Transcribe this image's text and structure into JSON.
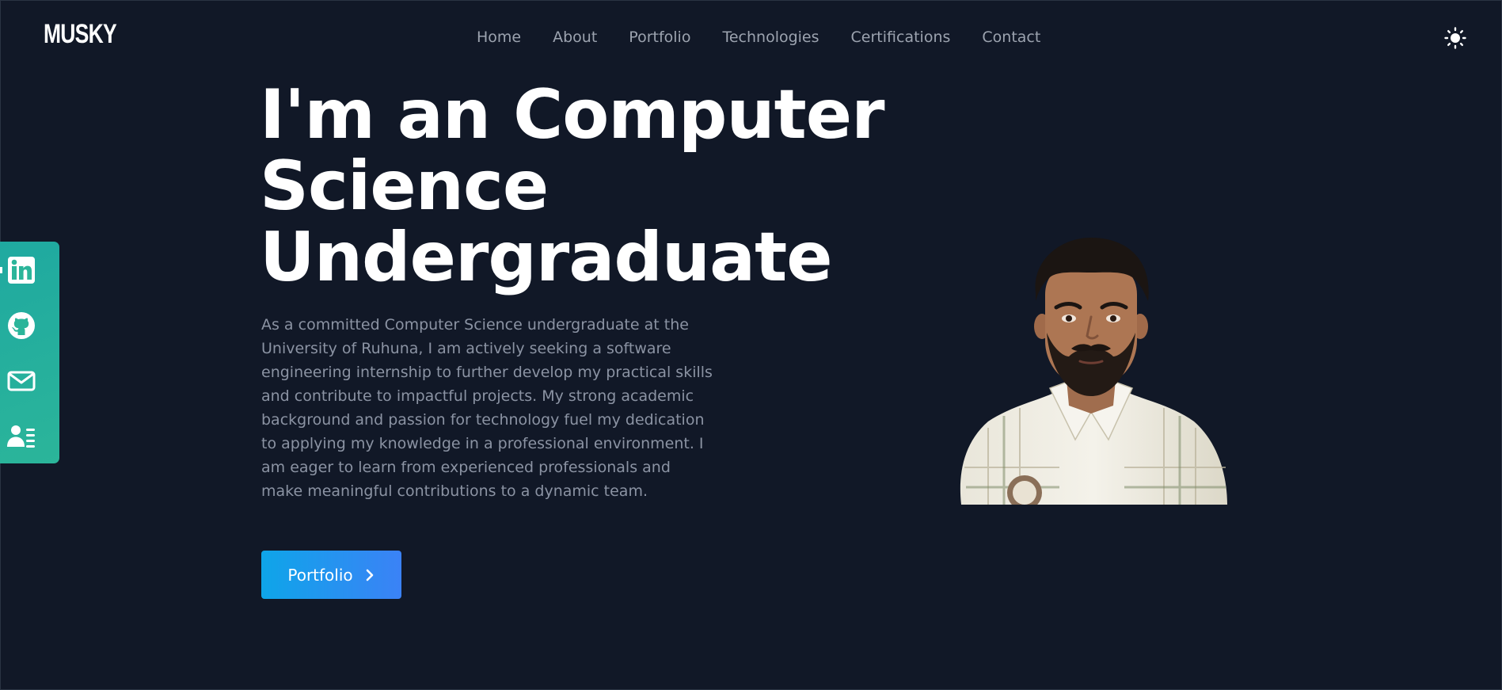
{
  "header": {
    "logo": "MUSKY",
    "nav": [
      "Home",
      "About",
      "Portfolio",
      "Technologies",
      "Certifications",
      "Contact"
    ],
    "theme_icon": "sun-icon"
  },
  "hero": {
    "title_line1": "I'm an Computer",
    "title_line2": "Science",
    "title_line3": "Undergraduate",
    "description": "As a committed Computer Science undergraduate at the University of Ruhuna, I am actively seeking a software engineering internship to further develop my practical skills and contribute to impactful projects. My strong academic background and passion for technology fuel my dedication to applying my knowledge in a professional environment. I am eager to learn from experienced professionals and make meaningful contributions to a dynamic team.",
    "cta_label": "Portfolio",
    "cta_icon": "chevron-right-icon"
  },
  "social": {
    "icons": [
      "linkedin-icon",
      "github-icon",
      "mail-icon",
      "resume-icon"
    ]
  },
  "colors": {
    "background": "#111827",
    "nav_text": "#9ca3af",
    "social_bar": "#2bb59a",
    "cta_gradient_start": "#0ea5e9",
    "cta_gradient_end": "#3b82f6"
  }
}
